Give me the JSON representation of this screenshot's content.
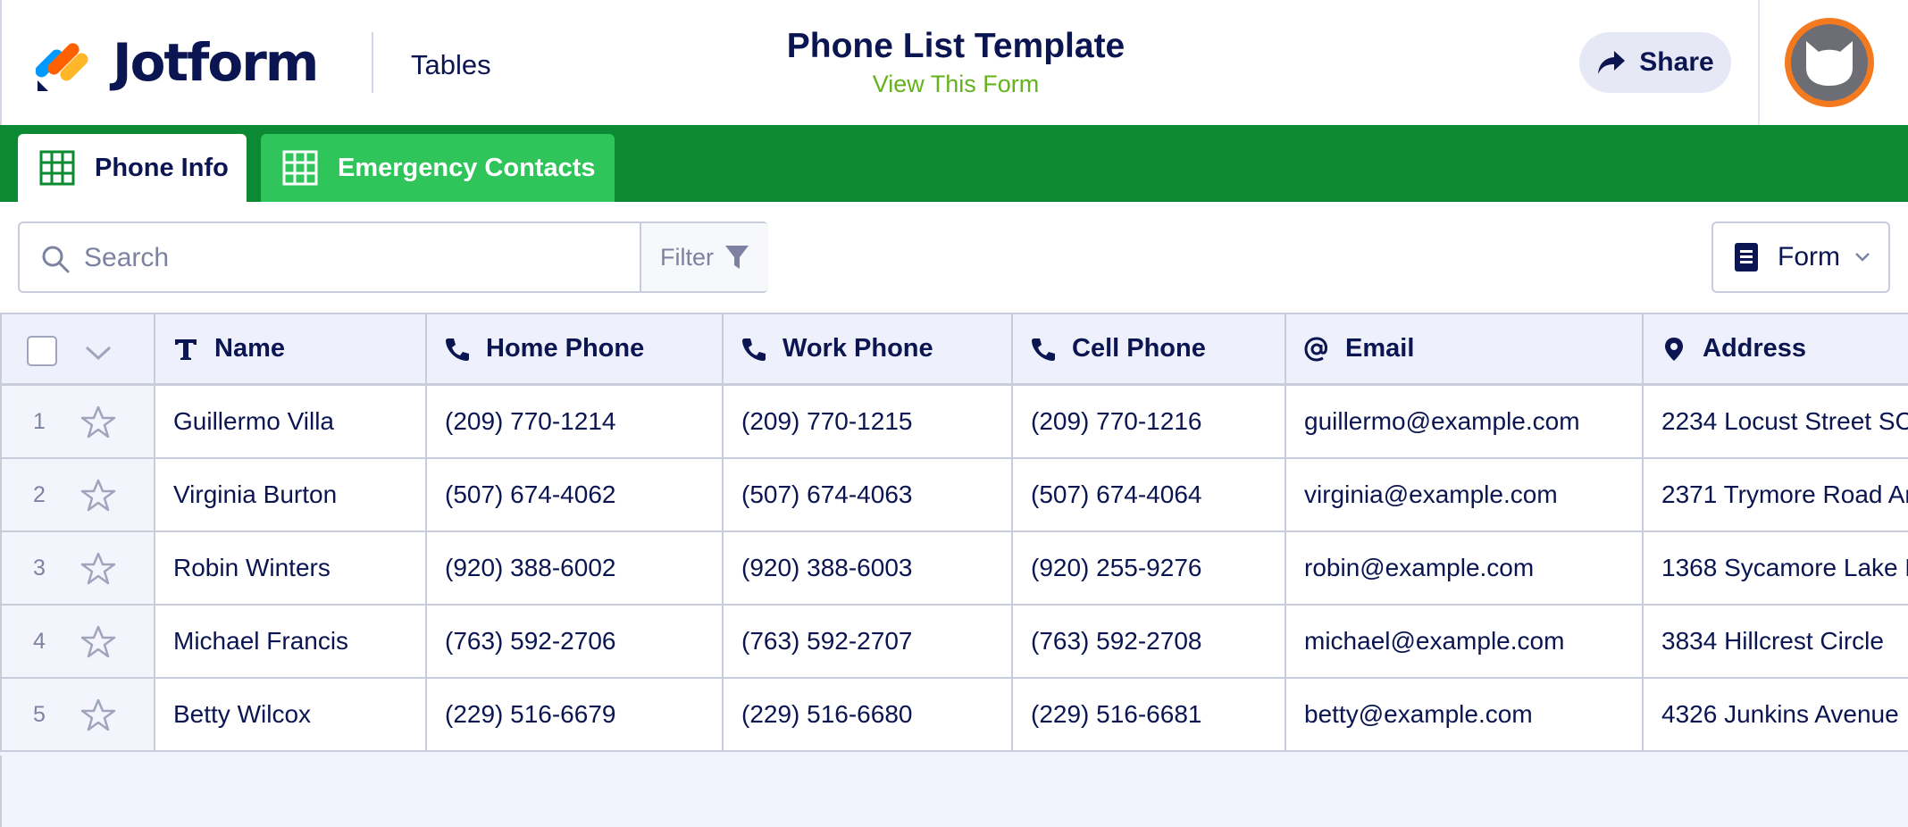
{
  "app": {
    "brand": "Jotform",
    "section": "Tables",
    "title": "Phone List Template",
    "subtitle_link": "View This Form",
    "share_label": "Share"
  },
  "tabs": [
    {
      "label": "Phone Info",
      "active": true
    },
    {
      "label": "Emergency Contacts",
      "active": false
    }
  ],
  "toolbar": {
    "search_placeholder": "Search",
    "filter_label": "Filter",
    "view_label": "Form"
  },
  "table": {
    "columns": [
      {
        "label": "Name",
        "icon": "text-type-icon"
      },
      {
        "label": "Home Phone",
        "icon": "phone-icon"
      },
      {
        "label": "Work Phone",
        "icon": "phone-icon"
      },
      {
        "label": "Cell Phone",
        "icon": "phone-icon"
      },
      {
        "label": "Email",
        "icon": "at-sign-icon"
      },
      {
        "label": "Address",
        "icon": "location-pin-icon"
      }
    ],
    "rows": [
      {
        "num": "1",
        "name": "Guillermo Villa",
        "home": "(209) 770-1214",
        "work": "(209) 770-1215",
        "cell": "(209) 770-1216",
        "email": "guillermo@example.com",
        "address": "2234 Locust Street  SC"
      },
      {
        "num": "2",
        "name": "Virginia Burton",
        "home": "(507) 674-4062",
        "work": "(507) 674-4063",
        "cell": "(507) 674-4064",
        "email": "virginia@example.com",
        "address": "2371 Trymore Road  An"
      },
      {
        "num": "3",
        "name": "Robin Winters",
        "home": "(920) 388-6002",
        "work": "(920) 388-6003",
        "cell": "(920) 255-9276",
        "email": "robin@example.com",
        "address": "1368 Sycamore Lake R"
      },
      {
        "num": "4",
        "name": "Michael Francis",
        "home": "(763) 592-2706",
        "work": "(763) 592-2707",
        "cell": "(763) 592-2708",
        "email": "michael@example.com",
        "address": "3834 Hillcrest Circle  "
      },
      {
        "num": "5",
        "name": "Betty Wilcox",
        "home": "(229) 516-6679",
        "work": "(229) 516-6680",
        "cell": "(229) 516-6681",
        "email": "betty@example.com",
        "address": "4326 Junkins Avenue"
      }
    ]
  },
  "colors": {
    "brand_navy": "#0a1551",
    "tab_bar_green": "#0b8a33",
    "inactive_tab_green": "#2fc55a",
    "link_green": "#64b21c",
    "avatar_orange": "#f47a20"
  }
}
